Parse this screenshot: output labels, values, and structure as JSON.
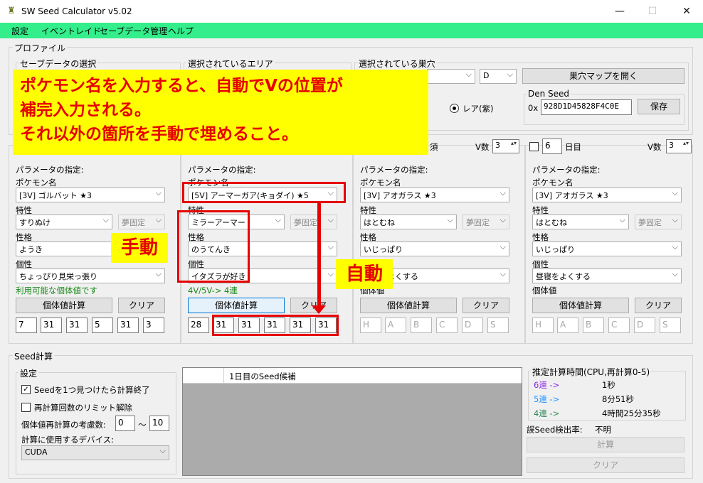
{
  "window": {
    "title": "SW Seed Calculator v5.02",
    "minimize": "—",
    "maximize": "☐",
    "close": "✕"
  },
  "menu": [
    "設定",
    "イベントレイド",
    "セーブデータ管理",
    "ヘルプ"
  ],
  "profile": {
    "legend": "プロファイル",
    "save_data_legend": "セーブデータの選択",
    "area_legend": "選択されているエリア",
    "den_legend": "選択されている巣穴",
    "den_letter": "D",
    "open_map": "巣穴マップを開く",
    "rare_label": "レア(紫)",
    "den_seed_label": "Den Seed",
    "den_seed_prefix": "0x",
    "den_seed_value": "928D1D45828F4C0E",
    "save": "保存"
  },
  "common": {
    "param": "パラメータの指定:",
    "pokemon": "ポケモン名",
    "ability": "特性",
    "nature": "性格",
    "characteristic": "個性",
    "ivs": "個体値",
    "calc_iv": "個体値計算",
    "clear": "クリア",
    "dream_fixed": "夢固定",
    "v_count": "V数",
    "day_suffix": "日目",
    "day_suffix2": "須"
  },
  "panels": [
    {
      "pokemon": "[3V] ゴルバット ★3",
      "ability": "すりぬけ",
      "nature": "ようき",
      "characteristic": "ちょっぴり見栄っ張り",
      "status": "利用可能な個体値です",
      "ivs": [
        "7",
        "31",
        "31",
        "5",
        "31",
        "3"
      ]
    },
    {
      "pokemon": "[5V] アーマーガア(キョダイ) ★5",
      "ability": "ミラーアーマー",
      "nature": "のうてんき",
      "characteristic": "イタズラが好き",
      "status": "4V/5V-> 4連",
      "ivs": [
        "28",
        "31",
        "31",
        "31",
        "31",
        "31"
      ]
    },
    {
      "pokemon": "[3V] アオガラス ★3",
      "ability": "はとむね",
      "nature": "いじっぱり",
      "characteristic": "昼寝をよくする",
      "v": "3",
      "ivs": [
        "H",
        "A",
        "B",
        "C",
        "D",
        "S"
      ]
    },
    {
      "pokemon": "[3V] アオガラス ★3",
      "ability": "はとむね",
      "nature": "いじっぱり",
      "characteristic": "昼寝をよくする",
      "day": "6",
      "v": "3",
      "ivs": [
        "H",
        "A",
        "B",
        "C",
        "D",
        "S"
      ]
    }
  ],
  "seed": {
    "legend": "Seed計算",
    "settings_legend": "設定",
    "stop_on_found": "Seedを1つ見つけたら計算終了",
    "unlimit": "再計算回数のリミット解除",
    "consider_label": "個体値再計算の考慮数:",
    "consider_from": "0",
    "tilde": "～",
    "consider_to": "10",
    "device_label": "計算に使用するデバイス:",
    "device": "CUDA",
    "table_header": "1日目のSeed候補",
    "estimate_legend": "推定計算時間(CPU,再計算0-5)",
    "estimates": [
      {
        "label": "6連 ->",
        "time": "1秒",
        "color": "#8a2be2"
      },
      {
        "label": "5連 ->",
        "time": "8分51秒",
        "color": "#1e90ff"
      },
      {
        "label": "4連 ->",
        "time": "4時間25分35秒",
        "color": "#2e8b57"
      }
    ],
    "false_rate_label": "誤Seed検出率:",
    "false_rate": "不明",
    "calc": "計算",
    "clear": "クリア"
  },
  "annotations": {
    "banner": [
      "ポケモン名を入力すると、自動でVの位置が",
      "補完入力される。",
      "それ以外の箇所を手動で埋めること。"
    ],
    "manual": "手動",
    "auto": "自動"
  }
}
